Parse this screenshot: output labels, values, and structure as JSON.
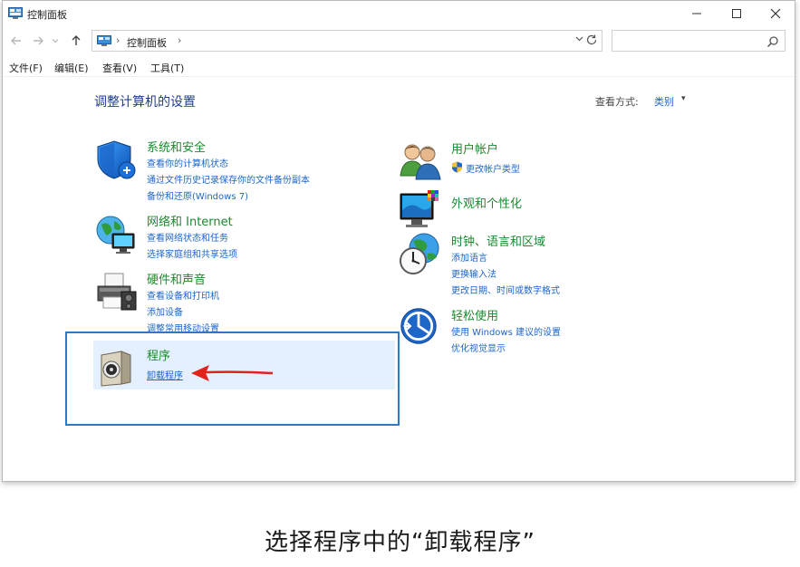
{
  "window": {
    "title": "控制面板",
    "controls": {
      "minimize": "minimize-icon",
      "maximize": "maximize-icon",
      "close": "close-icon"
    }
  },
  "navigation": {
    "back_icon": "arrow-left-icon",
    "forward_icon": "arrow-right-icon",
    "recent_icon": "chevron-down-icon",
    "up_icon": "arrow-up-icon",
    "address": {
      "location": "控制面板",
      "separator": "›"
    },
    "refresh_icon": "refresh-icon",
    "search": {
      "placeholder": "",
      "icon": "search-icon"
    }
  },
  "menubar": {
    "items": [
      "文件(F)",
      "编辑(E)",
      "查看(V)",
      "工具(T)"
    ]
  },
  "content": {
    "heading": "调整计算机的设置",
    "view_by": {
      "label": "查看方式:",
      "value": "类别",
      "caret": "▾"
    }
  },
  "categories_left": [
    {
      "title": "系统和安全",
      "icon": "shield-icon",
      "links": [
        "查看你的计算机状态",
        "通过文件历史记录保存你的文件备份副本",
        "备份和还原(Windows 7)"
      ]
    },
    {
      "title": "网络和 Internet",
      "icon": "network-globe-icon",
      "links": [
        "查看网络状态和任务",
        "选择家庭组和共享选项"
      ]
    },
    {
      "title": "硬件和声音",
      "icon": "printer-icon",
      "links": [
        "查看设备和打印机",
        "添加设备",
        "调整常用移动设置"
      ]
    },
    {
      "title": "程序",
      "icon": "programs-disk-icon",
      "links": [
        "卸载程序"
      ]
    }
  ],
  "categories_right": [
    {
      "title": "用户帐户",
      "icon": "users-icon",
      "links": [
        "更改帐户类型"
      ]
    },
    {
      "title": "外观和个性化",
      "icon": "monitor-palette-icon",
      "links": []
    },
    {
      "title": "时钟、语言和区域",
      "icon": "clock-globe-icon",
      "links": [
        "添加语言",
        "更换输入法",
        "更改日期、时间或数字格式"
      ]
    },
    {
      "title": "轻松使用",
      "icon": "accessibility-icon",
      "links": [
        "使用 Windows 建议的设置",
        "优化视觉显示"
      ]
    }
  ],
  "caption": "选择程序中的“卸载程序”",
  "colors": {
    "category_title": "#1a8a2e",
    "link": "#1e66c8",
    "heading": "#1e3c96",
    "highlight_box": "#2e78c6",
    "highlight_bg": "#e4efff",
    "annotation_arrow": "#e0221b"
  }
}
